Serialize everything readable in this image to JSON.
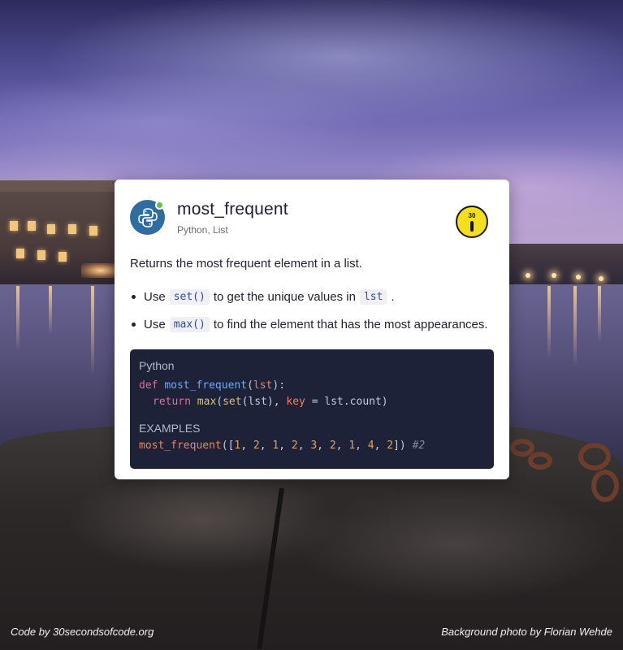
{
  "snippet": {
    "title": "most_frequent",
    "tags": "Python, List",
    "language_icon": "python-icon",
    "badge_icon": "thirty-seconds-stopwatch-icon",
    "badge_number": "30",
    "description": "Returns the most frequent element in a list.",
    "bullets": [
      {
        "before": "Use",
        "code": "set()",
        "after": "to get the unique values in",
        "code2": "lst",
        "end": "."
      },
      {
        "before": "Use",
        "code": "max()",
        "after": "to find the element that has the most appearances."
      }
    ],
    "code": {
      "language": "Python",
      "line1": {
        "kw": "def",
        "fn": "most_frequent",
        "open": "(",
        "param": "lst",
        "close": "):"
      },
      "line2": {
        "kw": "return",
        "bi1": "max",
        "p1": "(",
        "bi2": "set",
        "p2": "(lst), ",
        "param": "key",
        "eq": " = ",
        "rest": "lst.count)"
      },
      "examples_label": "EXAMPLES",
      "example_call": "most_frequent",
      "example_open": "([",
      "example_args": [
        "1",
        "2",
        "1",
        "2",
        "3",
        "2",
        "1",
        "4",
        "2"
      ],
      "example_close": "])",
      "example_result": "#2"
    }
  },
  "footer": {
    "credit_left": "Code by 30secondsofcode.org",
    "credit_right": "Background photo by Florian Wehde"
  },
  "colors": {
    "accent_blue": "#2f6ca2",
    "code_bg": "#1e2238",
    "badge_yellow": "#f3df1c"
  }
}
